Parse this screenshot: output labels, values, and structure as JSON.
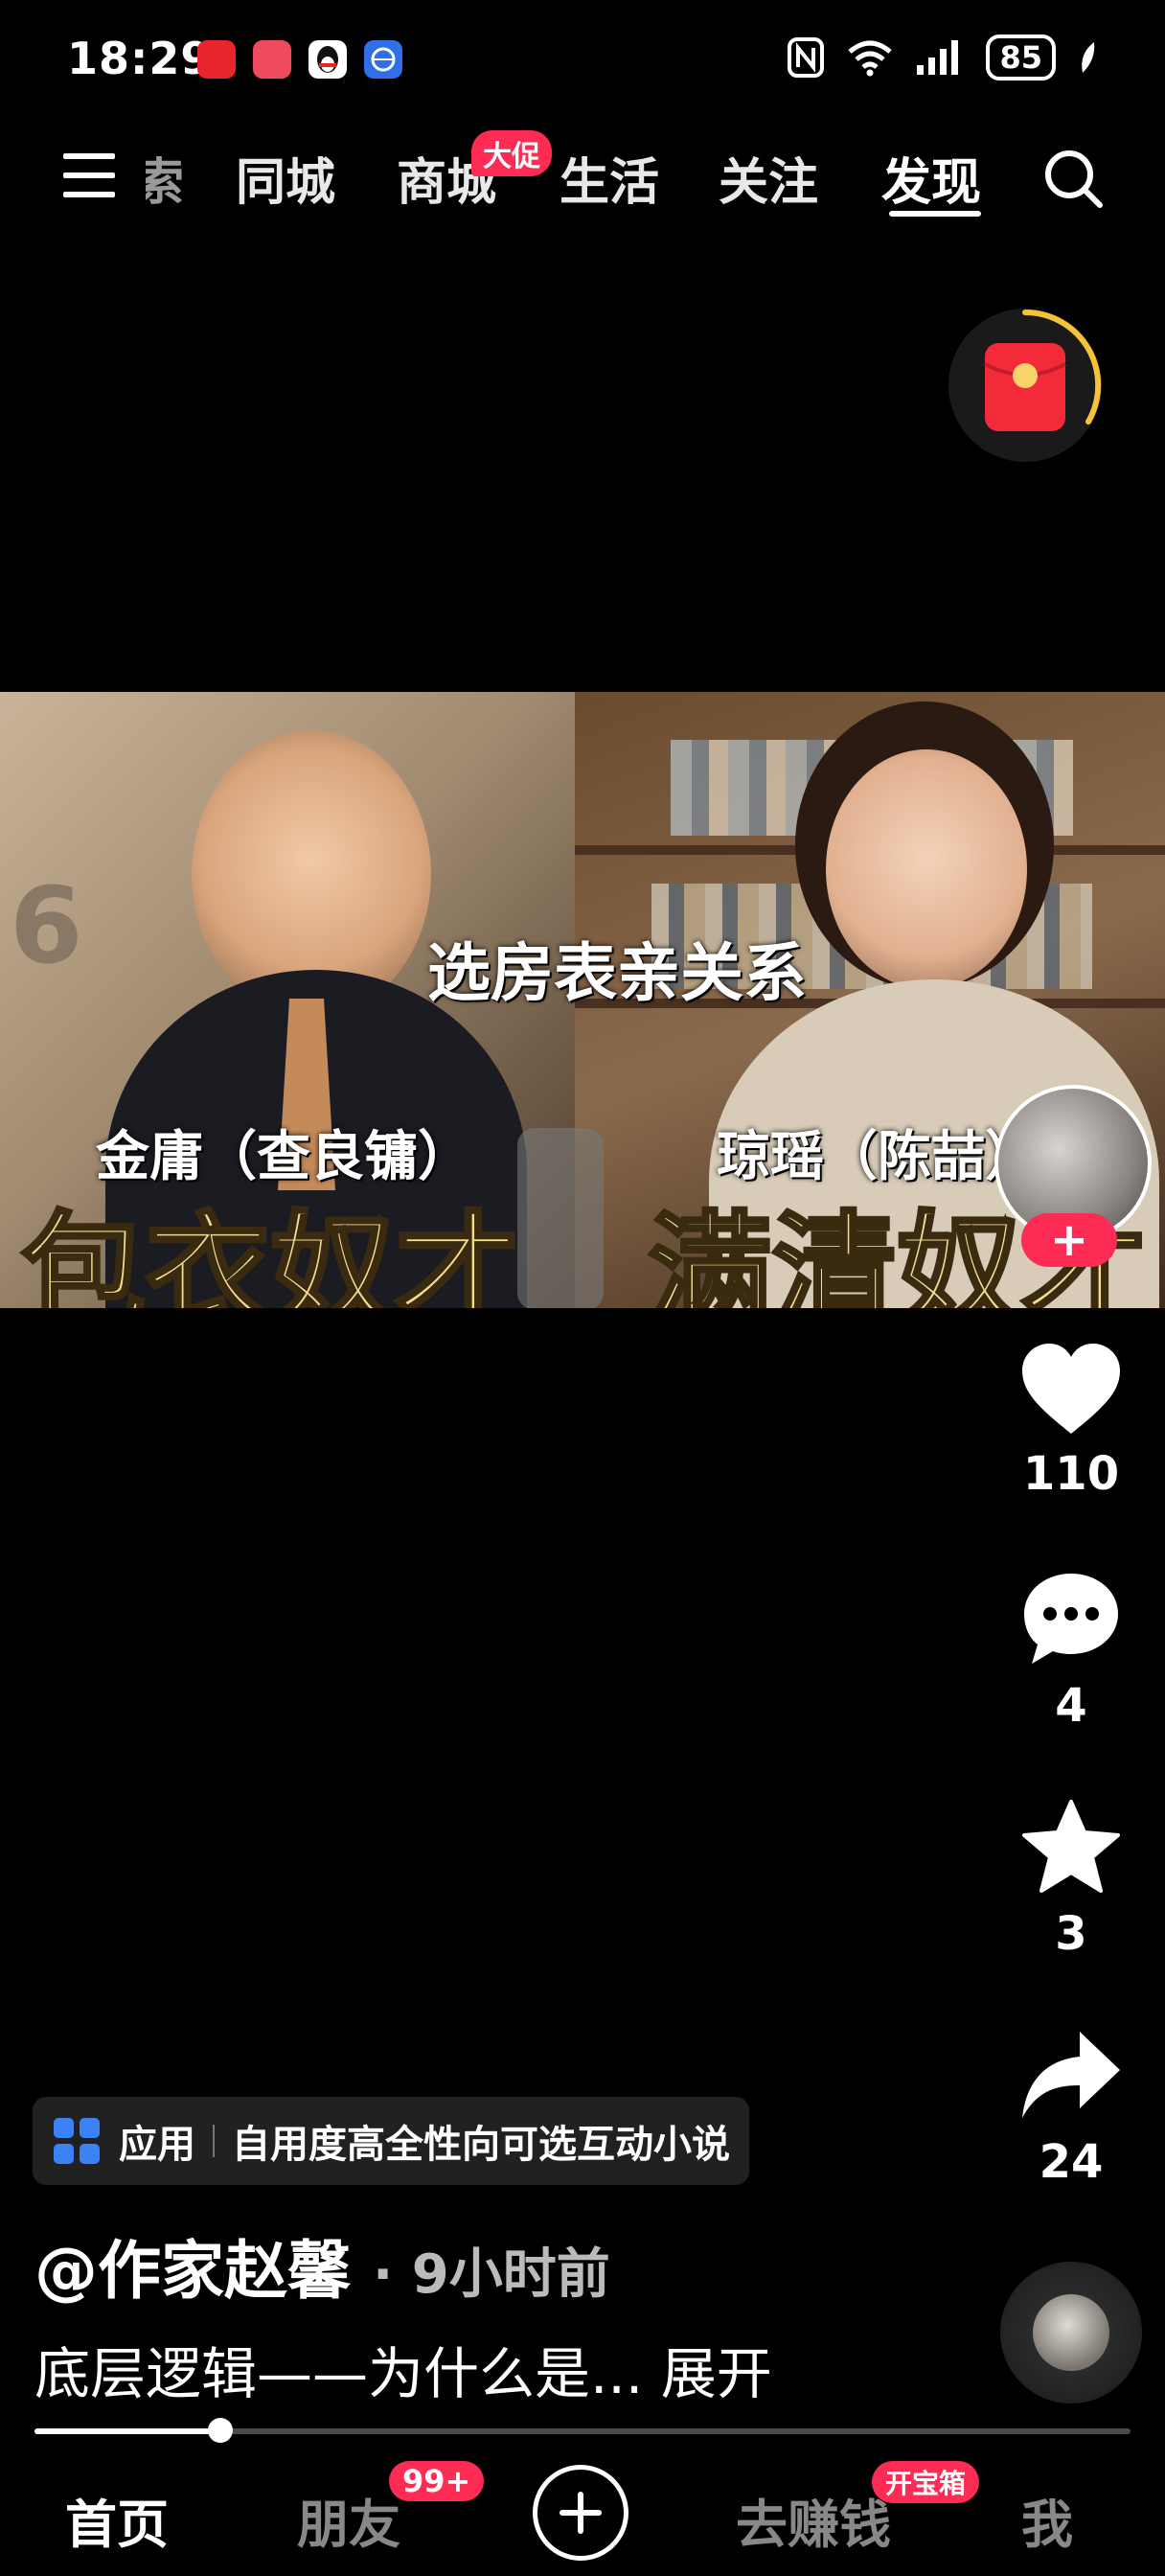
{
  "status_bar": {
    "time": "18:29",
    "battery": "85"
  },
  "top_nav": {
    "items": [
      {
        "label": "同城"
      },
      {
        "label": "商城",
        "badge": "大促"
      },
      {
        "label": "生活"
      },
      {
        "label": "关注"
      },
      {
        "label": "发现"
      }
    ],
    "active": "发现"
  },
  "video": {
    "overlay_title": "选房表亲关系",
    "left_name": "金庸（查良镛）",
    "left_label": "包衣奴才",
    "right_name": "琼瑶（陈喆）",
    "right_label": "满清奴才"
  },
  "actions": {
    "likes": "110",
    "comments": "4",
    "favorites": "3",
    "shares": "24"
  },
  "app_tag": {
    "type": "应用",
    "title": "自用度高全性向可选互动小说"
  },
  "post": {
    "author": "@作家赵馨",
    "time": "· 9小时前",
    "caption": "底层逻辑——为什么是...",
    "expand": "展开"
  },
  "playback_progress": 0.17,
  "tab_bar": {
    "home": "首页",
    "friends": "朋友",
    "friends_badge": "99+",
    "earn": "去赚钱",
    "earn_badge": "开宝箱",
    "me": "我"
  }
}
